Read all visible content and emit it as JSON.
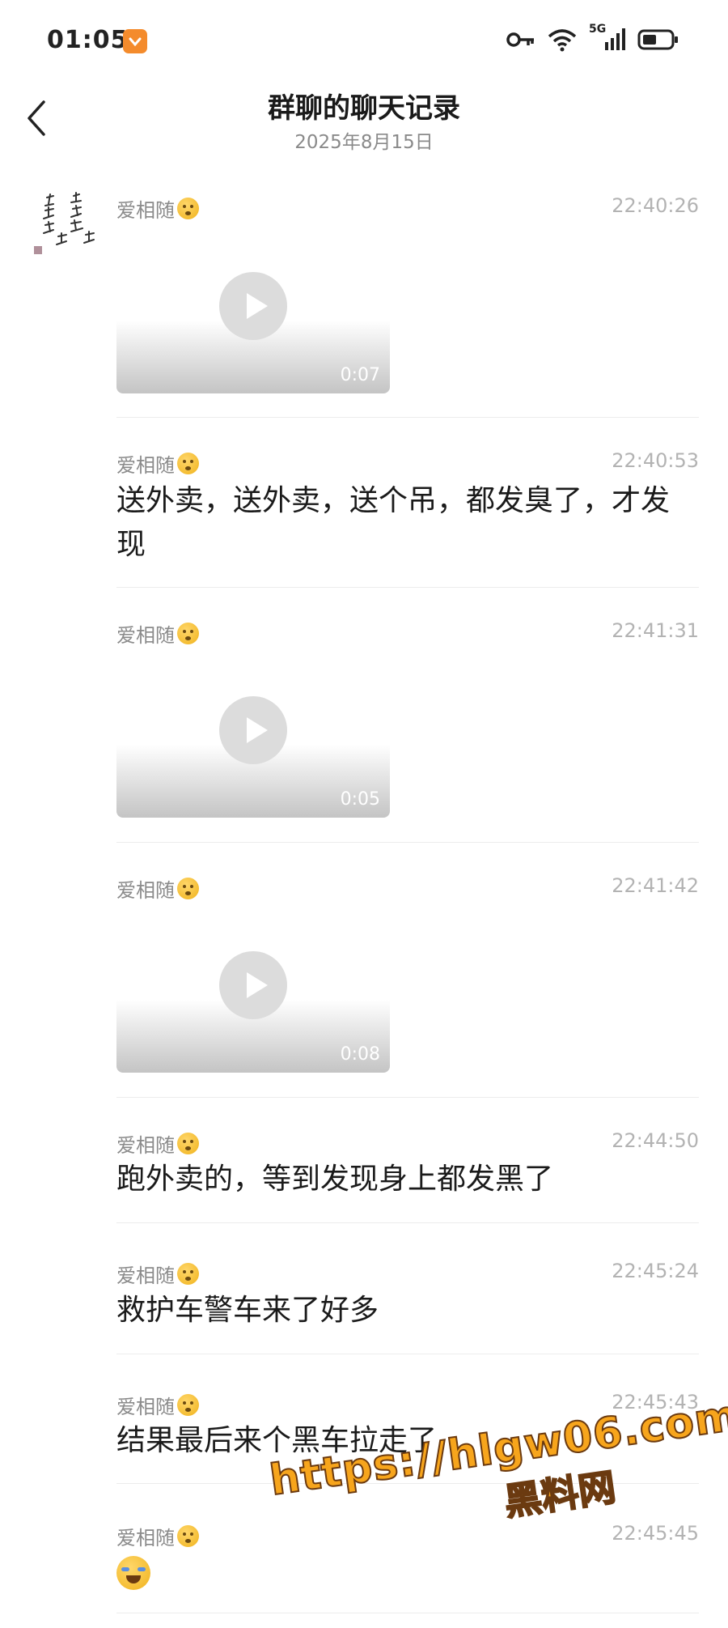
{
  "status_bar": {
    "time": "01:05",
    "network_label": "5G"
  },
  "header": {
    "title": "群聊的聊天记录",
    "date": "2025年8月15日"
  },
  "messages": [
    {
      "sender": "爱相随",
      "time": "22:40:26",
      "type": "video",
      "duration": "0:07"
    },
    {
      "sender": "爱相随",
      "time": "22:40:53",
      "type": "text",
      "text": "送外卖，送外卖，送个吊，都发臭了，才发现"
    },
    {
      "sender": "爱相随",
      "time": "22:41:31",
      "type": "video",
      "duration": "0:05"
    },
    {
      "sender": "爱相随",
      "time": "22:41:42",
      "type": "video",
      "duration": "0:08"
    },
    {
      "sender": "爱相随",
      "time": "22:44:50",
      "type": "text",
      "text": "跑外卖的，等到发现身上都发黑了"
    },
    {
      "sender": "爱相随",
      "time": "22:45:24",
      "type": "text",
      "text": "救护车警车来了好多"
    },
    {
      "sender": "爱相随",
      "time": "22:45:43",
      "type": "text",
      "text": "结果最后来个黑车拉走了"
    },
    {
      "sender": "爱相随",
      "time": "22:45:45",
      "type": "emoji"
    }
  ],
  "watermark": {
    "url": "https://hlgw06.com",
    "name": "黑料网"
  }
}
